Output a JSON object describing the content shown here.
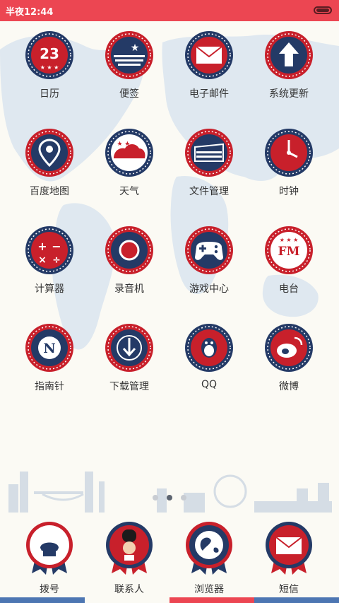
{
  "status_bar": {
    "time": "半夜12:44"
  },
  "apps": [
    {
      "label": "日历",
      "icon": "calendar-icon",
      "day": "23"
    },
    {
      "label": "便签",
      "icon": "notes-flag-icon"
    },
    {
      "label": "电子邮件",
      "icon": "email-icon"
    },
    {
      "label": "系统更新",
      "icon": "system-update-icon"
    },
    {
      "label": "百度地图",
      "icon": "map-pin-icon"
    },
    {
      "label": "天气",
      "icon": "weather-cloud-icon"
    },
    {
      "label": "文件管理",
      "icon": "file-manager-icon"
    },
    {
      "label": "时钟",
      "icon": "clock-icon"
    },
    {
      "label": "计算器",
      "icon": "calculator-icon"
    },
    {
      "label": "录音机",
      "icon": "recorder-icon"
    },
    {
      "label": "游戏中心",
      "icon": "gamepad-icon"
    },
    {
      "label": "电台",
      "icon": "radio-fm-icon",
      "badge": "FM"
    },
    {
      "label": "指南针",
      "icon": "compass-icon",
      "badge": "N"
    },
    {
      "label": "下载管理",
      "icon": "download-icon"
    },
    {
      "label": "QQ",
      "icon": "qq-penguin-icon"
    },
    {
      "label": "微博",
      "icon": "weibo-icon"
    }
  ],
  "dock": [
    {
      "label": "拨号",
      "icon": "phone-icon"
    },
    {
      "label": "联系人",
      "icon": "contacts-guard-icon"
    },
    {
      "label": "浏览器",
      "icon": "browser-globe-icon"
    },
    {
      "label": "短信",
      "icon": "messages-envelope-icon"
    }
  ],
  "page_indicator": {
    "count": 3,
    "active": 1
  },
  "colors": {
    "red": "#c8202b",
    "navy": "#243a66",
    "status_red": "#ec4652",
    "cream": "#fbfaf4"
  }
}
